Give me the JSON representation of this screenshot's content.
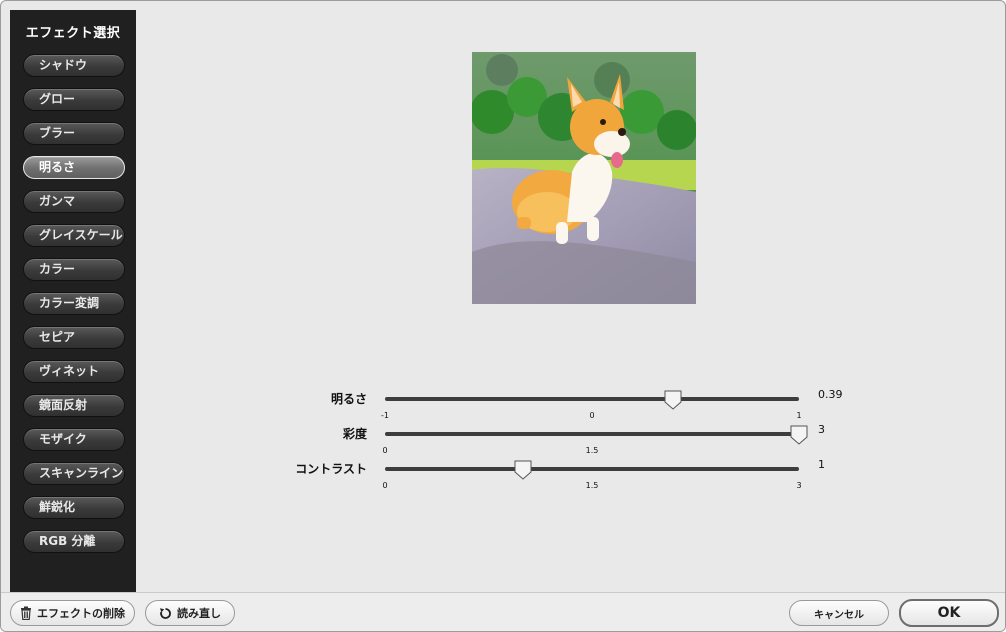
{
  "sidebar": {
    "title": "エフェクト選択",
    "items": [
      {
        "label": "シャドウ",
        "selected": false
      },
      {
        "label": "グロー",
        "selected": false
      },
      {
        "label": "ブラー",
        "selected": false
      },
      {
        "label": "明るさ",
        "selected": true
      },
      {
        "label": "ガンマ",
        "selected": false
      },
      {
        "label": "グレイスケール",
        "selected": false
      },
      {
        "label": "カラー",
        "selected": false
      },
      {
        "label": "カラー変調",
        "selected": false
      },
      {
        "label": "セピア",
        "selected": false
      },
      {
        "label": "ヴィネット",
        "selected": false
      },
      {
        "label": "鏡面反射",
        "selected": false
      },
      {
        "label": "モザイク",
        "selected": false
      },
      {
        "label": "スキャンライン",
        "selected": false
      },
      {
        "label": "鮮鋭化",
        "selected": false
      },
      {
        "label": "RGB 分離",
        "selected": false
      }
    ]
  },
  "preview": {
    "icon": "corgi-photo-preview"
  },
  "sliders": {
    "brightness": {
      "label": "明るさ",
      "min": -1,
      "max": 1,
      "value": 0.39,
      "value_text": "0.39",
      "ticks": [
        "-1",
        "0",
        "1"
      ]
    },
    "saturation": {
      "label": "彩度",
      "min": 0,
      "max": 3,
      "value": 3,
      "value_text": "3",
      "ticks": [
        "0",
        "1.5",
        ""
      ]
    },
    "contrast": {
      "label": "コントラスト",
      "min": 0,
      "max": 3,
      "value": 1,
      "value_text": "1",
      "ticks": [
        "0",
        "1.5",
        "3"
      ]
    }
  },
  "bottom_bar": {
    "delete_label": "エフェクトの削除",
    "delete_icon": "trash-icon",
    "reload_label": "読み直し",
    "reload_icon": "reload-icon",
    "cancel_label": "キャンセル",
    "ok_label": "OK"
  }
}
